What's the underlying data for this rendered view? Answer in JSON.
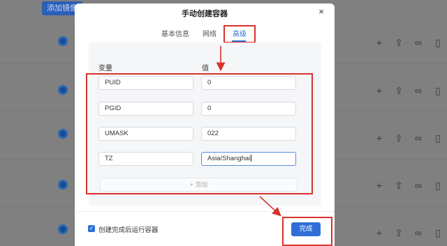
{
  "background": {
    "top_button_label": "添加镜像",
    "action_icons": [
      "plus-icon",
      "upload-icon",
      "link-icon",
      "trash-icon"
    ]
  },
  "modal": {
    "title": "手动创建容器",
    "close_label": "×",
    "tabs": [
      {
        "label": "基本信息",
        "active": false
      },
      {
        "label": "网络",
        "active": false
      },
      {
        "label": "高级",
        "active": true
      }
    ],
    "columns": {
      "variable": "变量",
      "value": "值"
    },
    "env_vars": [
      {
        "name": "PUID",
        "value": "0"
      },
      {
        "name": "PGID",
        "value": "0"
      },
      {
        "name": "UMASK",
        "value": "022"
      },
      {
        "name": "TZ",
        "value": "Asia/Shanghai"
      }
    ],
    "add_label": "+ 添加",
    "run_after_create": {
      "label": "创建完成后运行容器",
      "checked": true
    },
    "done_label": "完成"
  },
  "colors": {
    "accent": "#2f6fd6",
    "highlight": "#d8322d"
  }
}
